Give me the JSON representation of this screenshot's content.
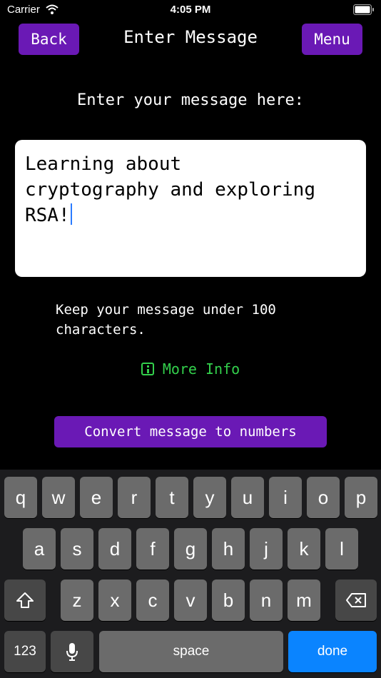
{
  "status_bar": {
    "carrier": "Carrier",
    "time": "4:05 PM"
  },
  "nav": {
    "back_label": "Back",
    "title": "Enter Message",
    "menu_label": "Menu"
  },
  "prompt": "Enter your message here:",
  "message": {
    "line1": "Learning about",
    "line2": "cryptography and exploring",
    "line3": "RSA!"
  },
  "hint": {
    "line1": "Keep your message under 100",
    "line2": "characters."
  },
  "more_info_label": "More Info",
  "convert_label": "Convert message to numbers",
  "keyboard": {
    "row1": [
      "q",
      "w",
      "e",
      "r",
      "t",
      "y",
      "u",
      "i",
      "o",
      "p"
    ],
    "row2": [
      "a",
      "s",
      "d",
      "f",
      "g",
      "h",
      "j",
      "k",
      "l"
    ],
    "row3": [
      "z",
      "x",
      "c",
      "v",
      "b",
      "n",
      "m"
    ],
    "numbers_label": "123",
    "space_label": "space",
    "done_label": "done"
  },
  "colors": {
    "accent_purple": "#6a19b5",
    "info_green": "#33d04c",
    "done_blue": "#0a84ff"
  }
}
